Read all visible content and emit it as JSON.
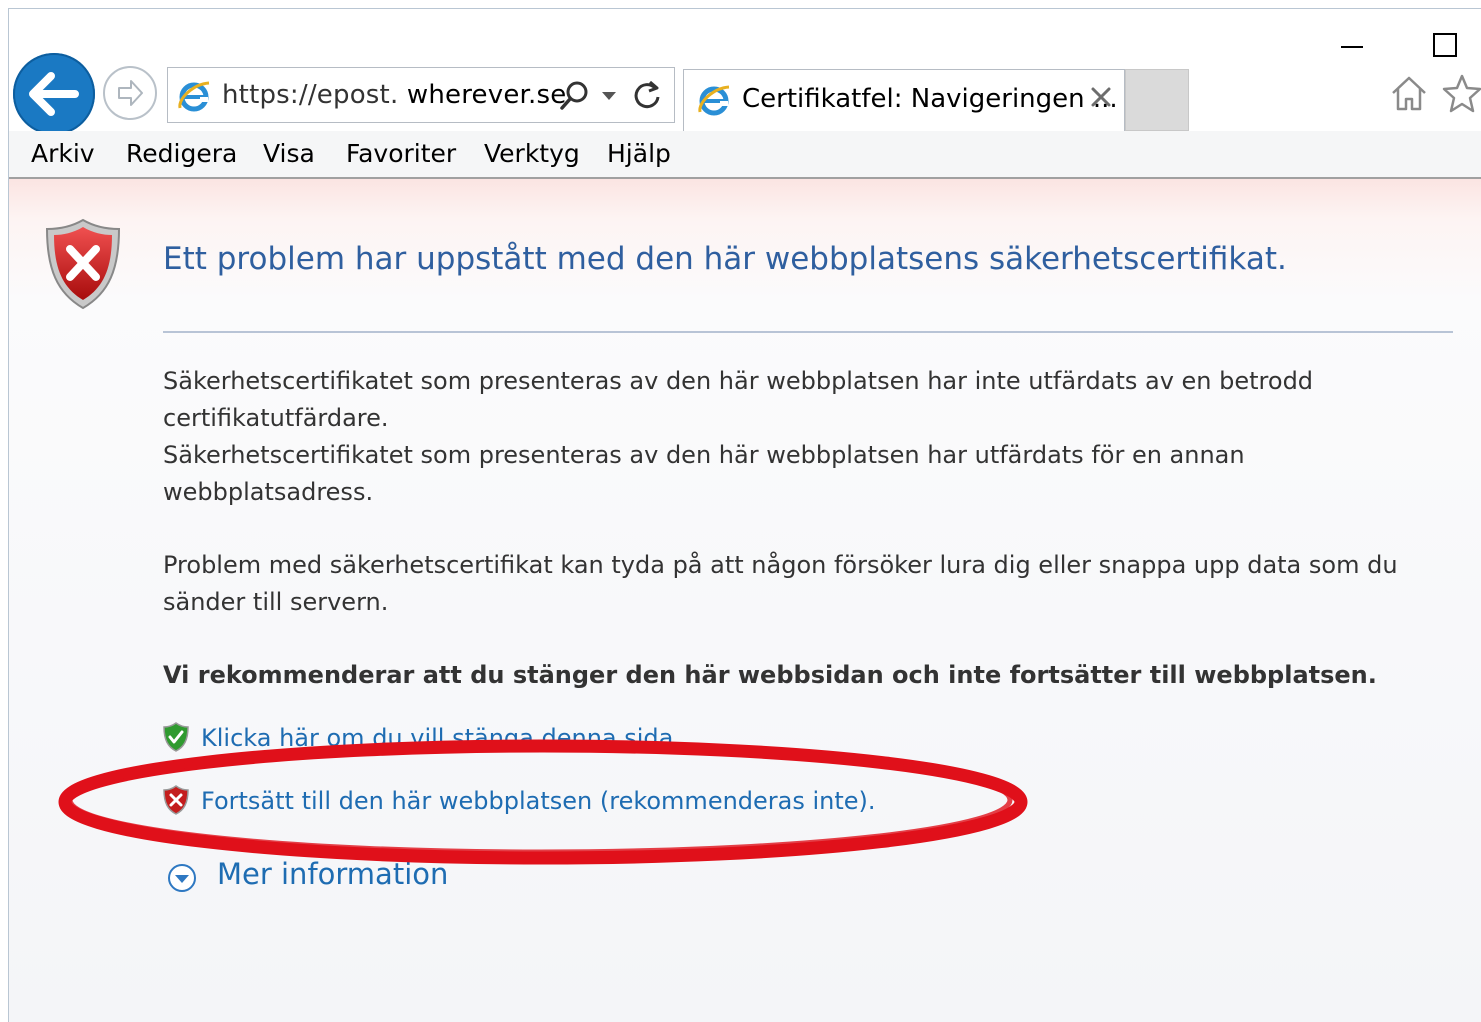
{
  "window": {
    "controls": {
      "minimize": "minimize",
      "maximize": "maximize"
    }
  },
  "nav": {
    "address": {
      "scheme": "https://epost.",
      "host": "wherever.se"
    },
    "tab": {
      "title": "Certifikatfel: Navigeringen ..."
    }
  },
  "menubar": {
    "items": [
      {
        "label": "Arkiv"
      },
      {
        "label": "Redigera"
      },
      {
        "label": "Visa"
      },
      {
        "label": "Favoriter"
      },
      {
        "label": "Verktyg"
      },
      {
        "label": "Hjälp"
      }
    ]
  },
  "page": {
    "heading": "Ett problem har uppstått med den här webbplatsens säkerhetscertifikat.",
    "paragraph1_line1": "Säkerhetscertifikatet som presenteras av den här webbplatsen har inte utfärdats av en betrodd certifikatutfärdare.",
    "paragraph1_line2": "Säkerhetscertifikatet som presenteras av den här webbplatsen har utfärdats för en annan webbplatsadress.",
    "paragraph2": "Problem med säkerhetscertifikat kan tyda på att någon försöker lura dig eller snappa upp data som du sänder till servern.",
    "recommendation": "Vi rekommenderar att du stänger den här webbsidan och inte fortsätter till webbplatsen.",
    "close_link": "Klicka här om du vill stänga denna sida.",
    "continue_link": "Fortsätt till den här webbplatsen (rekommenderas inte).",
    "more_info": "Mer information"
  },
  "colors": {
    "heading": "#2f5f9f",
    "link": "#1e6cb2",
    "annotation": "#e0101a",
    "back_button": "#1a79c3"
  },
  "icons": {
    "back": "arrow-left-icon",
    "forward": "arrow-right-icon",
    "ie": "ie-logo-icon",
    "search": "search-icon",
    "refresh": "refresh-icon",
    "close": "close-icon",
    "home": "home-icon",
    "favorites": "star-icon",
    "error_shield": "shield-error-icon",
    "safe_shield": "shield-check-icon",
    "expand": "chevron-down-circle-icon"
  }
}
